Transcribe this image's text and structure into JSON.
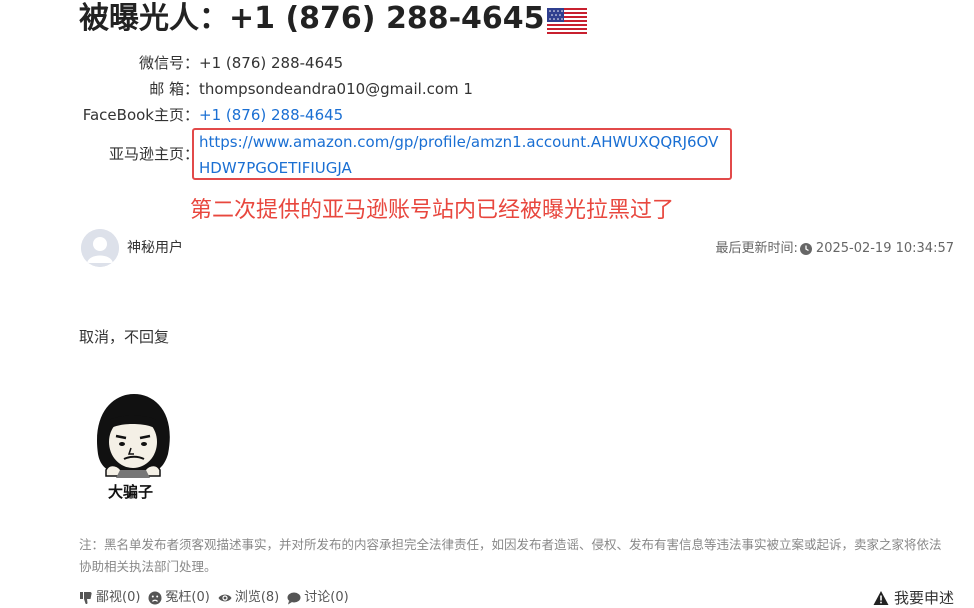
{
  "header": {
    "title": "被曝光人：+1 (876) 288-4645",
    "flag_icon": "us-flag-icon"
  },
  "info": {
    "wechat_label": "微信号：",
    "wechat_value": "+1 (876) 288-4645",
    "email_label": "邮 箱：",
    "email_value": "thompsondeandra010@gmail.com 1",
    "facebook_label": "FaceBook主页：",
    "facebook_value": "+1 (876) 288-4645",
    "amazon_label": "亚马逊主页：",
    "amazon_value": "https://www.amazon.com/gp/profile/amzn1.account.AHWUXQQRJ6OVHDW7PGOETIFIUGJA"
  },
  "annotation": {
    "warning_text": "第二次提供的亚马逊账号站内已经被曝光拉黑过了",
    "color": "#e8473e"
  },
  "post": {
    "user_name": "神秘用户",
    "updated_label": "最后更新时间:",
    "updated_time": "2025-02-19 10:34:57",
    "reply_text": "取消，不回复",
    "meme_caption": "大骗子"
  },
  "note": {
    "text": "注：黑名单发布者须客观描述事实，并对所发布的内容承担完全法律责任，如因发布者造谣、侵权、发布有害信息等违法事实被立案或起诉，卖家之家将依法协助相关执法部门处理。"
  },
  "footer": {
    "dislike": "鄙视(0)",
    "wronged": "冤枉(0)",
    "views": "浏览(8)",
    "comments": "讨论(0)",
    "complain": "我要申述"
  },
  "colors": {
    "link": "#1a6fd3",
    "highlight_border": "#e24a4a"
  }
}
